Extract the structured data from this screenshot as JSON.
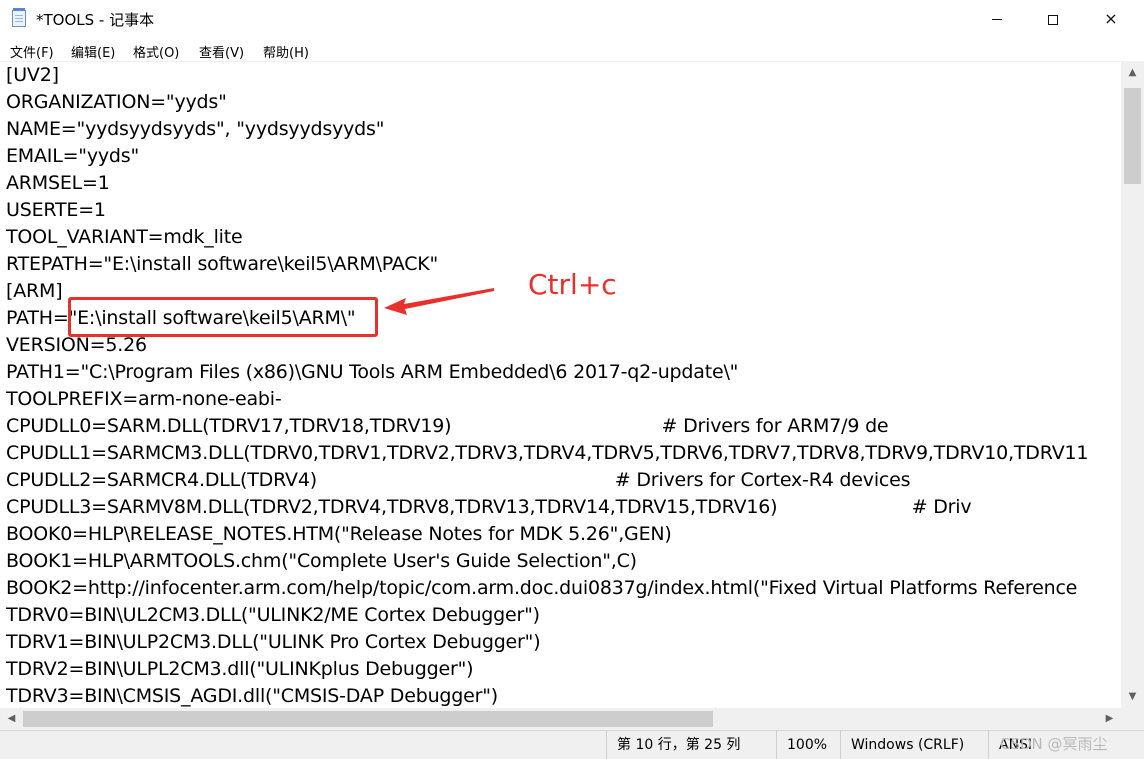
{
  "window": {
    "title": "*TOOLS - 记事本",
    "icon": "notepad-icon",
    "controls": {
      "minimize": "minimize-icon",
      "maximize": "maximize-icon",
      "close": "×"
    }
  },
  "menu": {
    "items": [
      "文件(F)",
      "编辑(E)",
      "格式(O)",
      "查看(V)",
      "帮助(H)"
    ]
  },
  "editor": {
    "lines": [
      "[UV2]",
      "ORGANIZATION=\"yyds\"",
      "NAME=\"yydsyydsyyds\", \"yydsyydsyyds\"",
      "EMAIL=\"yyds\"",
      "ARMSEL=1",
      "USERTE=1",
      "TOOL_VARIANT=mdk_lite",
      "RTEPATH=\"E:\\install software\\keil5\\ARM\\PACK\"",
      "[ARM]",
      "PATH=\"E:\\install software\\keil5\\ARM\\\"",
      "VERSION=5.26",
      "PATH1=\"C:\\Program Files (x86)\\GNU Tools ARM Embedded\\6 2017-q2-update\\\"",
      "TOOLPREFIX=arm-none-eabi-",
      "CPUDLL0=SARM.DLL(TDRV17,TDRV18,TDRV19)                                    # Drivers for ARM7/9 de",
      "CPUDLL1=SARMCM3.DLL(TDRV0,TDRV1,TDRV2,TDRV3,TDRV4,TDRV5,TDRV6,TDRV7,TDRV8,TDRV9,TDRV10,TDRV11",
      "CPUDLL2=SARMCR4.DLL(TDRV4)                                                   # Drivers for Cortex-R4 devices",
      "CPUDLL3=SARMV8M.DLL(TDRV2,TDRV4,TDRV8,TDRV13,TDRV14,TDRV15,TDRV16)                       # Driv",
      "BOOK0=HLP\\RELEASE_NOTES.HTM(\"Release Notes for MDK 5.26\",GEN)",
      "BOOK1=HLP\\ARMTOOLS.chm(\"Complete User's Guide Selection\",C)",
      "BOOK2=http://infocenter.arm.com/help/topic/com.arm.doc.dui0837g/index.html(\"Fixed Virtual Platforms Reference",
      "TDRV0=BIN\\UL2CM3.DLL(\"ULINK2/ME Cortex Debugger\")",
      "TDRV1=BIN\\ULP2CM3.DLL(\"ULINK Pro Cortex Debugger\")",
      "TDRV2=BIN\\ULPL2CM3.dll(\"ULINKplus Debugger\")",
      "TDRV3=BIN\\CMSIS_AGDI.dll(\"CMSIS-DAP Debugger\")"
    ]
  },
  "annotation": {
    "label": "Ctrl+c",
    "color": "#e8302c"
  },
  "status": {
    "position": "第 10 行，第 25 列",
    "zoom": "100%",
    "line_ending": "Windows (CRLF)",
    "encoding": "ANSI"
  },
  "watermark": "CSDN @冥雨尘"
}
